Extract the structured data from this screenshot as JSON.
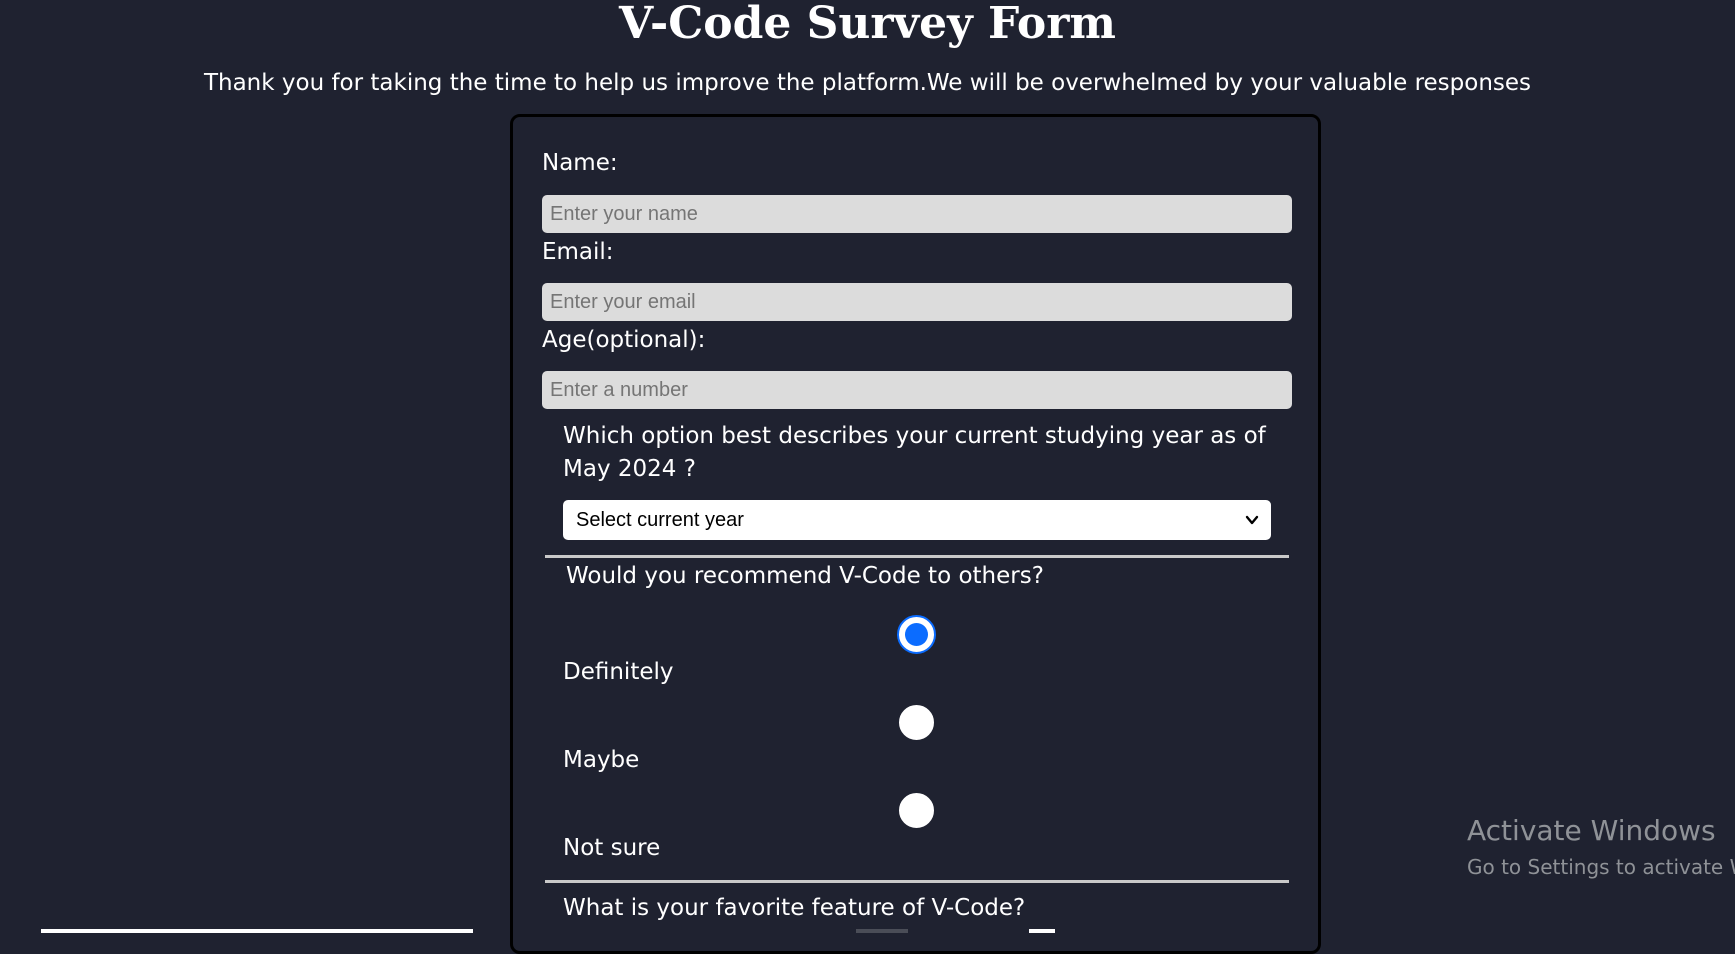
{
  "header": {
    "title": "V-Code Survey Form",
    "subtitle": "Thank you for taking the time to help us improve the platform.We will be overwhelmed by your valuable responses"
  },
  "form": {
    "name": {
      "label": "Name:",
      "placeholder": "Enter your name",
      "value": ""
    },
    "email": {
      "label": "Email:",
      "placeholder": "Enter your email",
      "value": ""
    },
    "age": {
      "label": "Age(optional):",
      "placeholder": "Enter a number",
      "value": ""
    },
    "studying_year": {
      "question": "Which option best describes your current studying year as of May 2024 ?",
      "selected": "Select current year",
      "icon": "chevron-down-icon"
    },
    "recommend": {
      "question": "Would you recommend V-Code to others?",
      "options": [
        {
          "label": "Definitely",
          "checked": true
        },
        {
          "label": "Maybe",
          "checked": false
        },
        {
          "label": "Not sure",
          "checked": false
        }
      ],
      "accent_color": "#0b6cff"
    },
    "favorite_feature": {
      "question": "What is your favorite feature of V-Code?"
    }
  },
  "watermark": {
    "title": "Activate Windows",
    "subtitle": "Go to Settings to activate W"
  },
  "colors": {
    "background": "#1f2230",
    "input_background": "#dcdcdc",
    "text": "#ffffff"
  }
}
